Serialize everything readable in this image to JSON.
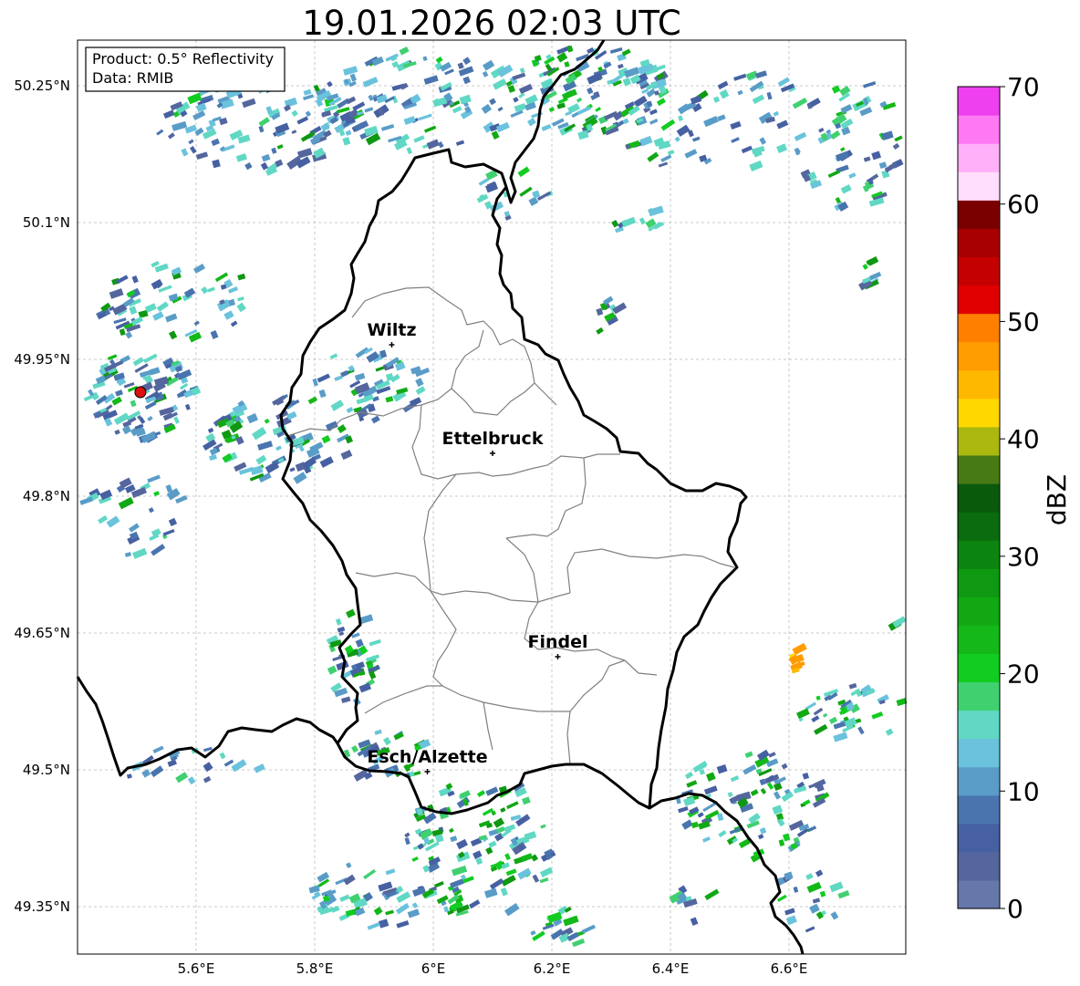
{
  "title": "19.01.2026 02:03 UTC",
  "info_box": {
    "product": "Product: 0.5° Reflectivity",
    "data": "Data: RMIB"
  },
  "map": {
    "lon_range": [
      5.4,
      6.8
    ],
    "lat_range": [
      49.3,
      50.3
    ],
    "lon_ticks": [
      {
        "value": 5.6,
        "label": "5.6°E"
      },
      {
        "value": 5.8,
        "label": "5.8°E"
      },
      {
        "value": 6.0,
        "label": "6°E"
      },
      {
        "value": 6.2,
        "label": "6.2°E"
      },
      {
        "value": 6.4,
        "label": "6.4°E"
      },
      {
        "value": 6.6,
        "label": "6.6°E"
      }
    ],
    "lat_ticks": [
      {
        "value": 50.25,
        "label": "50.25°N"
      },
      {
        "value": 50.1,
        "label": "50.1°N"
      },
      {
        "value": 49.95,
        "label": "49.95°N"
      },
      {
        "value": 49.8,
        "label": "49.8°N"
      },
      {
        "value": 49.65,
        "label": "49.65°N"
      },
      {
        "value": 49.5,
        "label": "49.5°N"
      },
      {
        "value": 49.35,
        "label": "49.35°N"
      }
    ],
    "cities": [
      {
        "name": "Wiltz",
        "lon": 5.93,
        "lat": 49.966
      },
      {
        "name": "Ettelbruck",
        "lon": 6.1,
        "lat": 49.847
      },
      {
        "name": "Findel",
        "lon": 6.21,
        "lat": 49.624
      },
      {
        "name": "Esch/Alzette",
        "lon": 5.99,
        "lat": 49.498
      }
    ],
    "radar_site": {
      "lon": 5.506,
      "lat": 49.914,
      "color": "#dd1111"
    }
  },
  "colorbar": {
    "label": "dBZ",
    "min": 0,
    "max": 70,
    "ticks": [
      0,
      10,
      20,
      30,
      40,
      50,
      60,
      70
    ],
    "colors": [
      "#6677aa",
      "#55669e",
      "#4660a2",
      "#4a74ae",
      "#5a9cc8",
      "#6ac2dc",
      "#60d8c4",
      "#40d070",
      "#12cc22",
      "#14b818",
      "#12a814",
      "#0f9812",
      "#0c8410",
      "#0a6c0e",
      "#0a5a0c",
      "#487a14",
      "#aab810",
      "#ffd800",
      "#ffb800",
      "#ff9c00",
      "#ff8000",
      "#e00000",
      "#c40000",
      "#a80000",
      "#7a0000",
      "#ffddfc",
      "#ffb0f8",
      "#ff78f4",
      "#ee40ee"
    ]
  },
  "legend_colors": {
    "border_country": "#000000",
    "border_canton": "#808080"
  }
}
